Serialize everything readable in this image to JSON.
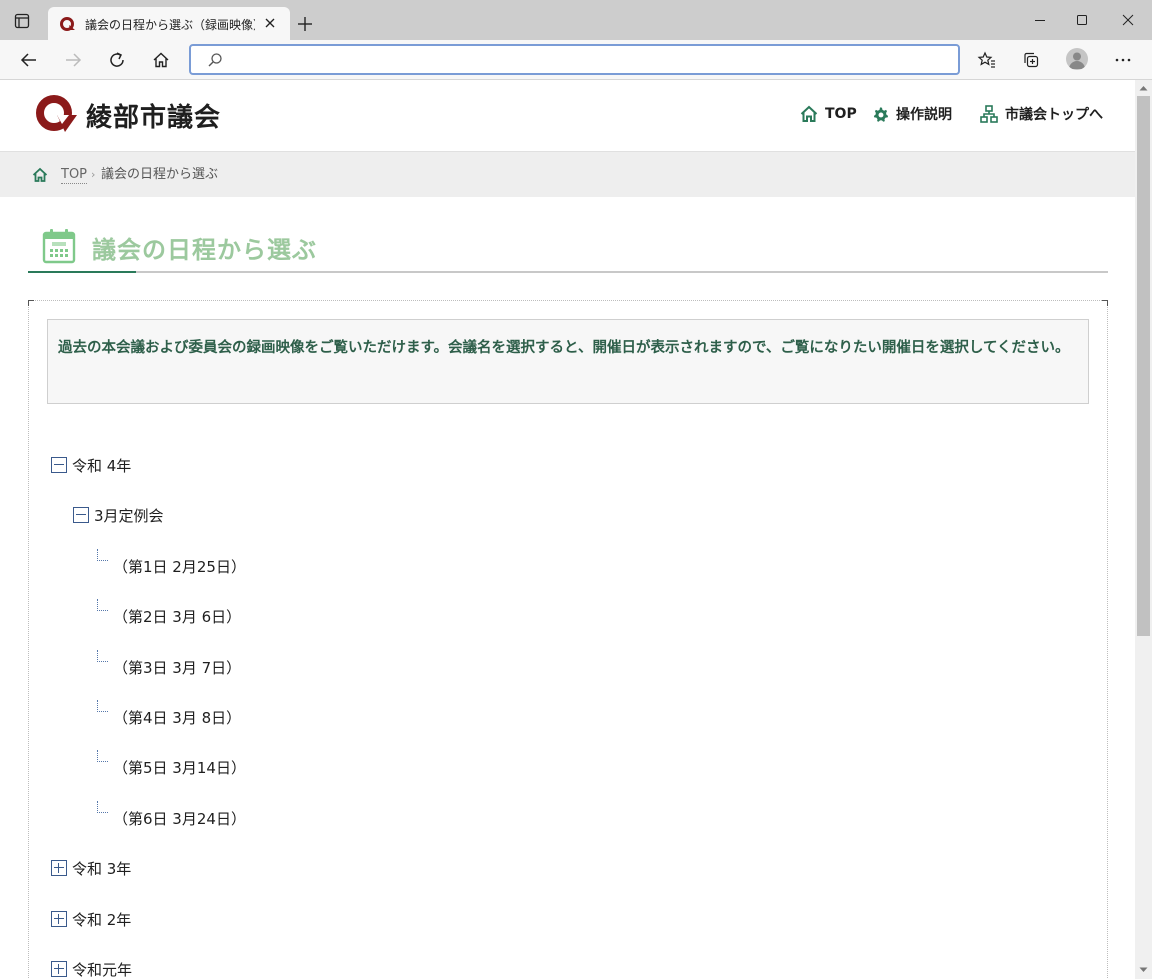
{
  "browser": {
    "tab_title": "議会の日程から選ぶ（録画映像）",
    "address": ""
  },
  "header": {
    "site_name": "綾部市議会",
    "nav": [
      {
        "label": "TOP",
        "icon": "home-icon"
      },
      {
        "label": "操作説明",
        "icon": "gear-icon"
      },
      {
        "label": "市議会トップへ",
        "icon": "sitemap-icon"
      }
    ]
  },
  "breadcrumb": {
    "top": "TOP",
    "separator": "›",
    "current": "議会の日程から選ぶ"
  },
  "page": {
    "title": "議会の日程から選ぶ",
    "notice": "過去の本会議および委員会の録画映像をご覧いただけます。会議名を選択すると、開催日が表示されますので、ご覧になりたい開催日を選択してください。"
  },
  "tree": {
    "years": [
      {
        "label": "令和 4年",
        "expanded": true
      },
      {
        "label": "令和 3年",
        "expanded": false
      },
      {
        "label": "令和 2年",
        "expanded": false
      },
      {
        "label": "令和元年",
        "expanded": false
      }
    ],
    "session": {
      "label": "3月定例会",
      "expanded": true
    },
    "days": [
      "（第1日 2月25日）",
      "（第2日 3月 6日）",
      "（第3日 3月 7日）",
      "（第4日 3月 8日）",
      "（第5日 3月14日）",
      "（第6日 3月24日）"
    ]
  },
  "colors": {
    "accent_green": "#2a7a5a",
    "title_green": "#9cc99e",
    "notice_text": "#2e5f4a",
    "logo_red": "#8b1a1a"
  }
}
